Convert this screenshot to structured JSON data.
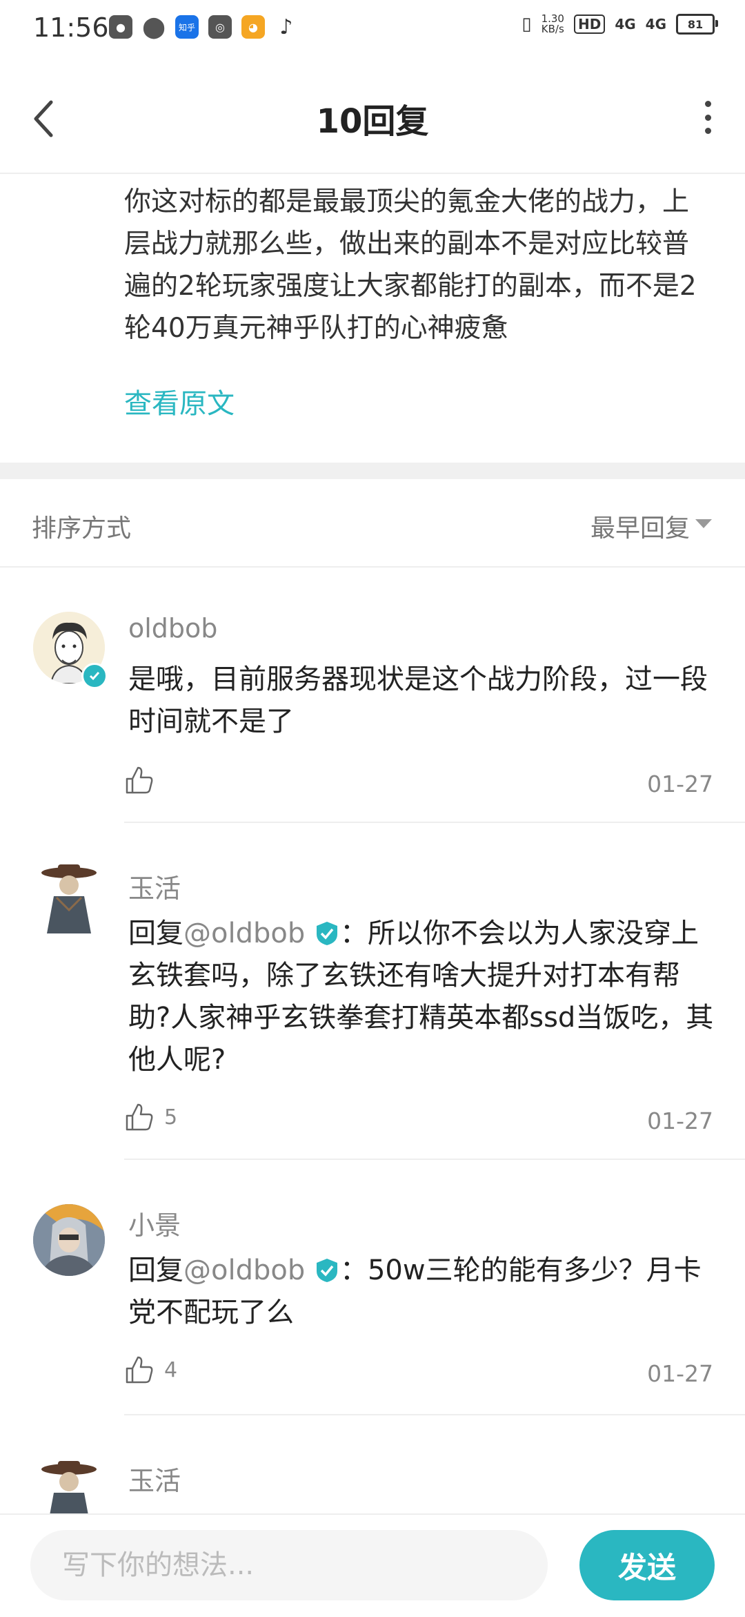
{
  "status_bar": {
    "time": "11:56",
    "app_icons": [
      "app-icon",
      "location-icon",
      "zhihu-icon",
      "camera-icon",
      "cat-icon",
      "tiktok-icon"
    ],
    "zhihu_label": "知乎",
    "net_speed_value": "1.30",
    "net_speed_unit": "KB/s",
    "hd_label": "HD",
    "signal_1": "4G",
    "signal_2": "4G",
    "battery": "81"
  },
  "header": {
    "title": "10回复"
  },
  "original_post": {
    "text": "你这对标的都是最最顶尖的氪金大佬的战力，上层战力就那么些，做出来的副本不是对应比较普遍的2轮玩家强度让大家都能打的副本，而不是2轮40万真元神乎队打的心神疲惫",
    "view_original_label": "查看原文"
  },
  "sort": {
    "label": "排序方式",
    "value": "最早回复"
  },
  "comments": [
    {
      "username": "oldbob",
      "verified": true,
      "text": "是哦，目前服务器现状是这个战力阶段，过一段时间就不是了",
      "likes": "",
      "date": "01-27"
    },
    {
      "username": "玉活",
      "reply_prefix": "回复",
      "reply_to": "@oldbob",
      "text": "：所以你不会以为人家没穿上玄铁套吗，除了玄铁还有啥大提升对打本有帮助?人家神乎玄铁拳套打精英本都ssd当饭吃，其他人呢?",
      "likes": "5",
      "date": "01-27"
    },
    {
      "username": "小景",
      "reply_prefix": "回复",
      "reply_to": "@oldbob",
      "text": "：50w三轮的能有多少？月卡党不配玩了么",
      "likes": "4",
      "date": "01-27"
    },
    {
      "username": "玉活"
    }
  ],
  "bottom_bar": {
    "input_placeholder": "写下你的想法...",
    "send_label": "发送"
  },
  "colors": {
    "accent": "#2ab7c1",
    "muted_text": "#888888"
  }
}
